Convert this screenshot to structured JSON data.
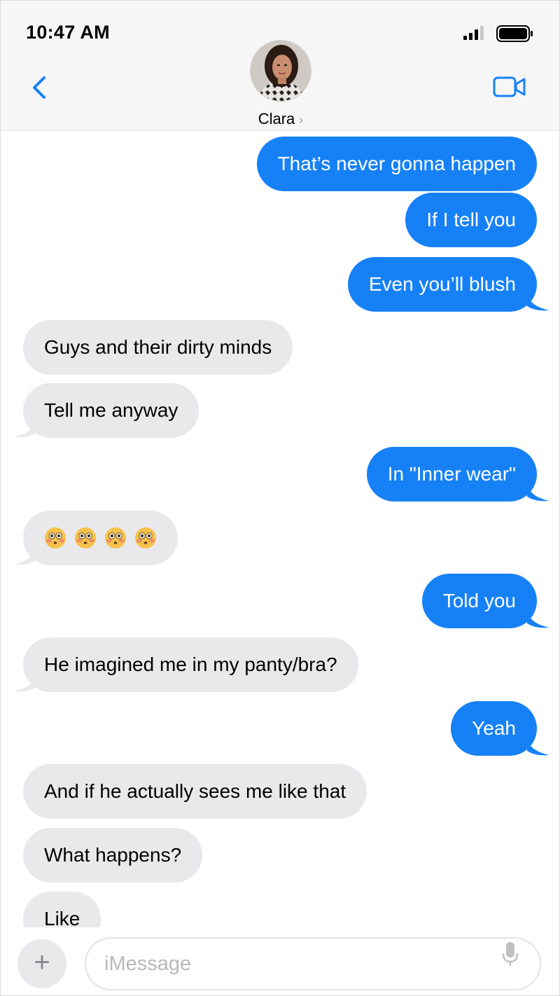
{
  "status": {
    "time": "10:47 AM"
  },
  "header": {
    "contact_name": "Clara",
    "chevron": "›"
  },
  "colors": {
    "sent": "#1681f7",
    "received": "#e9e9eb",
    "accent": "#1681f7"
  },
  "messages": [
    {
      "side": "sent",
      "text": "That’s never gonna happen"
    },
    {
      "side": "sent",
      "text": "If I tell you"
    },
    {
      "side": "sent",
      "text": "Even you’ll blush"
    },
    {
      "side": "received",
      "text": "Guys and their dirty minds"
    },
    {
      "side": "received",
      "text": "Tell me anyway"
    },
    {
      "side": "sent",
      "text": "In \"Inner wear\""
    },
    {
      "side": "received",
      "emoji": "flushed-face",
      "count": 4
    },
    {
      "side": "sent",
      "text": "Told you"
    },
    {
      "side": "received",
      "text": "He imagined me in my panty/bra?"
    },
    {
      "side": "sent",
      "text": "Yeah"
    },
    {
      "side": "received",
      "text": "And if he actually sees me like that"
    },
    {
      "side": "received",
      "text": "What happens?"
    },
    {
      "side": "received",
      "text": "Like"
    }
  ],
  "composer": {
    "placeholder": "iMessage",
    "plus_label": "+"
  },
  "icons": {
    "back": "chevron-left-icon",
    "video": "video-camera-icon",
    "mic": "microphone-icon",
    "signal": "cellular-signal-icon",
    "battery": "battery-icon"
  }
}
